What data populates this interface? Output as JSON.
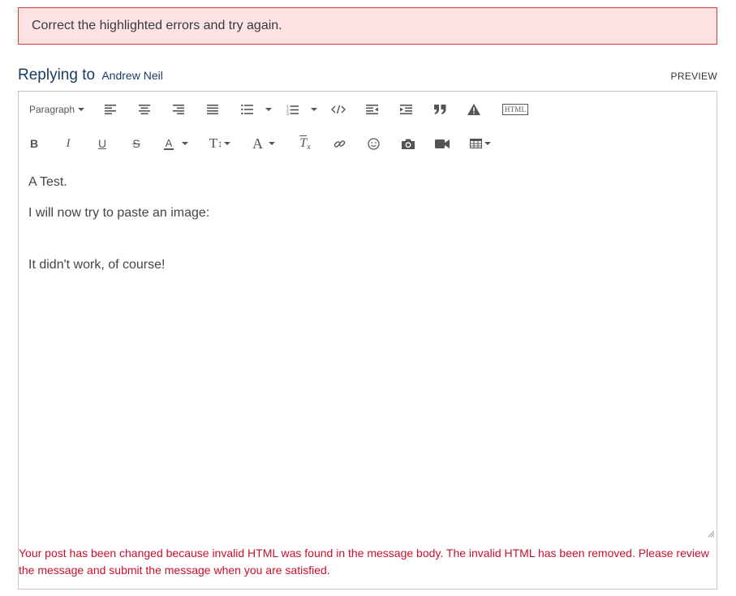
{
  "alert": {
    "text": "Correct the highlighted errors and try again."
  },
  "reply": {
    "label": "Replying to",
    "user": "Andrew Neil",
    "preview": "PREVIEW"
  },
  "toolbar": {
    "paragraph_label": "Paragraph",
    "html_label": "HTML"
  },
  "content": {
    "lines": [
      "A Test.",
      "I will now try to paste an image:",
      "It didn't work, of course!"
    ]
  },
  "error": {
    "text": "Your post has been changed because invalid HTML was found in the message body. The invalid HTML has been removed. Please review the message and submit the message when you are satisfied."
  },
  "colors": {
    "alert_bg": "#fde3e3",
    "alert_border": "#d9393a",
    "error_text": "#c8102e",
    "title": "#1a3a63"
  }
}
